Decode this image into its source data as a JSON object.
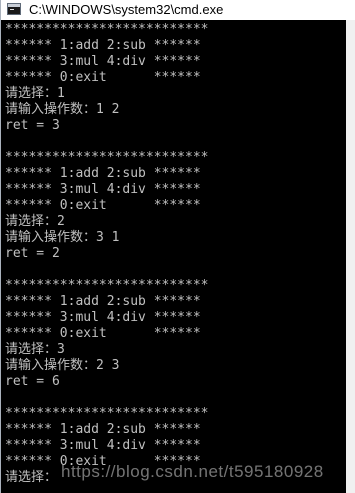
{
  "window": {
    "title": "C:\\WINDOWS\\system32\\cmd.exe",
    "icon": "console-app-icon"
  },
  "console": {
    "lines": [
      "**************************",
      "****** 1:add 2:sub ******",
      "****** 3:mul 4:div ******",
      "****** 0:exit      ******",
      "请选择：1",
      "请输入操作数：1 2",
      "ret = 3",
      "",
      "**************************",
      "****** 1:add 2:sub ******",
      "****** 3:mul 4:div ******",
      "****** 0:exit      ******",
      "请选择：2",
      "请输入操作数：3 1",
      "ret = 2",
      "",
      "**************************",
      "****** 1:add 2:sub ******",
      "****** 3:mul 4:div ******",
      "****** 0:exit      ******",
      "请选择：3",
      "请输入操作数：2 3",
      "ret = 6",
      "",
      "**************************",
      "****** 1:add 2:sub ******",
      "****** 3:mul 4:div ******",
      "****** 0:exit      ******",
      "请选择："
    ]
  },
  "watermark": "https://blog.csdn.net/t595180928",
  "colors": {
    "console_bg": "#000000",
    "console_fg": "#c0c0c0",
    "titlebar_bg": "#ffffff"
  }
}
